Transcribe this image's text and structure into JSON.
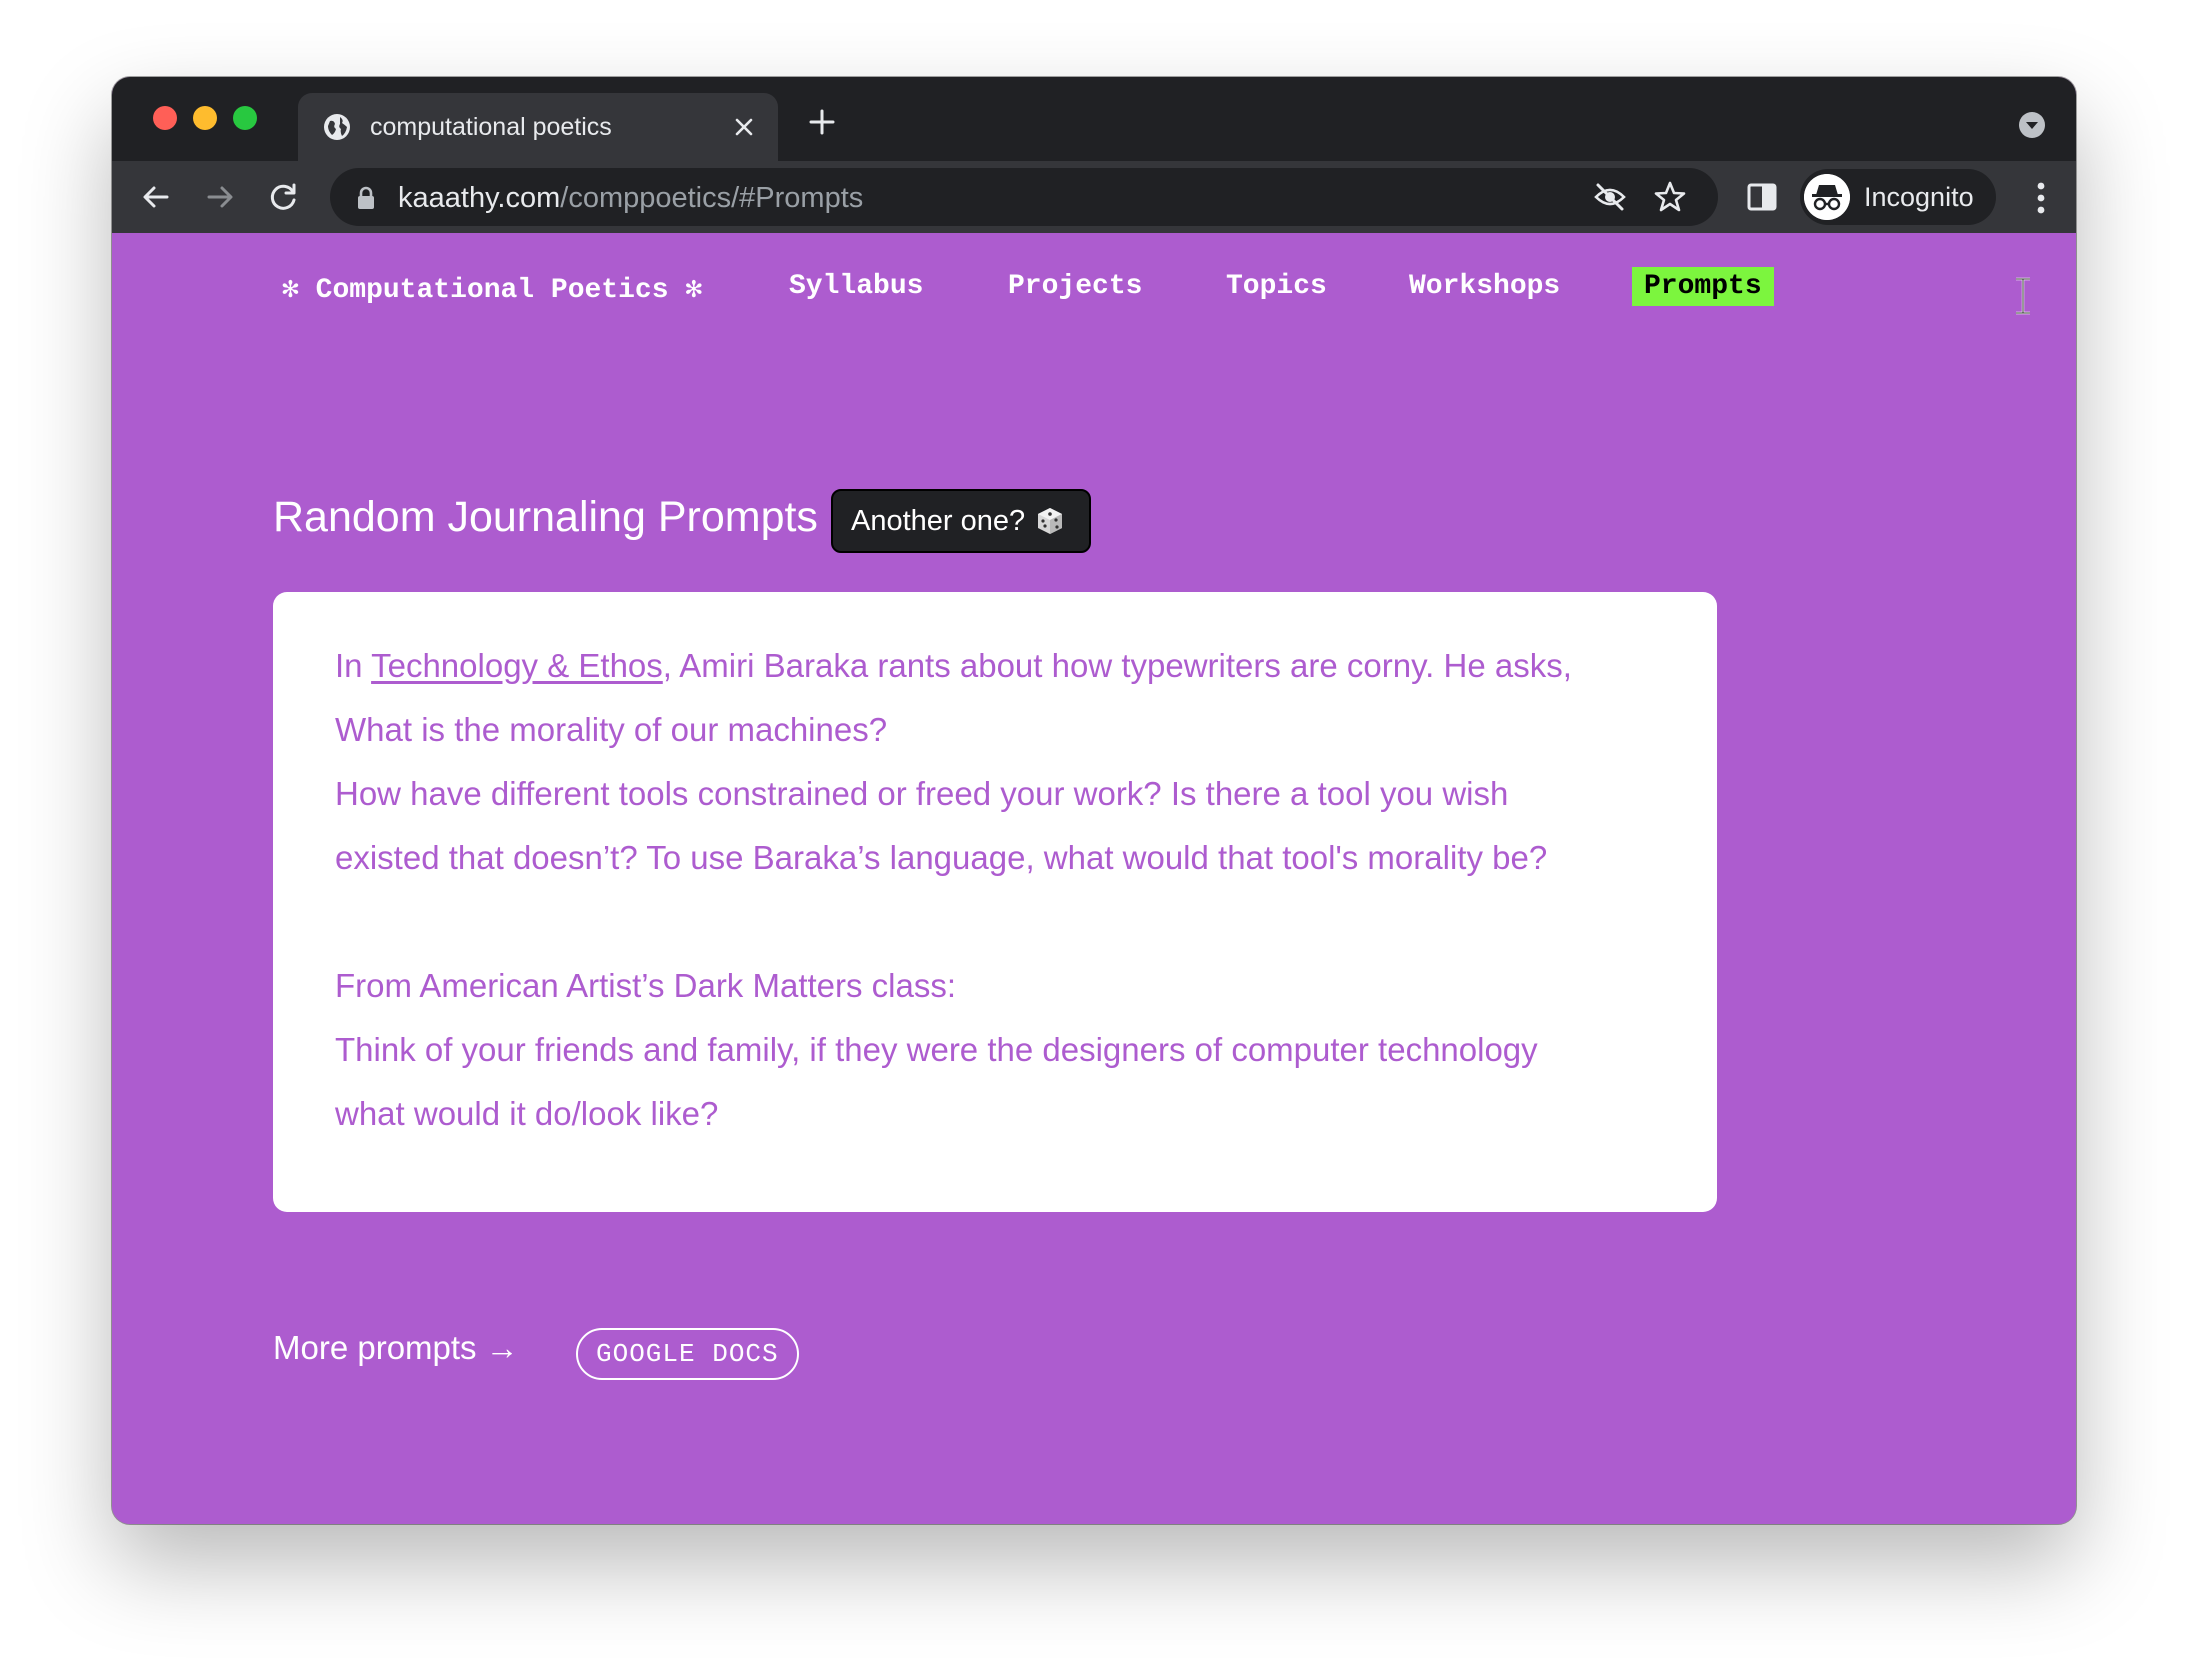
{
  "browser": {
    "tab_title": "computational poetics",
    "url_host": "kaaathy.com",
    "url_path": "/comppoetics/#Prompts",
    "incognito_label": "Incognito"
  },
  "nav": {
    "brand": "✻ Computational Poetics ✻",
    "items": [
      {
        "label": "Syllabus"
      },
      {
        "label": "Projects"
      },
      {
        "label": "Topics"
      },
      {
        "label": "Workshops"
      },
      {
        "label": "Prompts",
        "active": true
      }
    ],
    "active_color": "#7cf53e"
  },
  "main": {
    "heading": "Random Journaling Prompts",
    "another_button": "Another one?",
    "prompt": {
      "intro_prefix": "In ",
      "link_text": "Technology & Ethos",
      "intro_suffix": ", Amiri Baraka rants about how typewriters are corny. He asks,",
      "line2": "What is the morality of our machines?",
      "line3": "How have different tools constrained or freed your work? Is there a tool you wish",
      "line4": "existed that doesn’t? To use Baraka’s language, what would that tool's morality be?",
      "line5": "From American Artist’s Dark Matters class:",
      "line6": "Think of your friends and family, if they were the designers of computer technology",
      "line7": "what would it do/look like?"
    },
    "more_prompts": "More prompts →",
    "google_docs": "GOOGLE DOCS"
  },
  "colors": {
    "page_bg": "#ad5ccf",
    "card_text": "#ad5ccf",
    "button_bg": "#202124"
  },
  "icons": [
    "globe-icon",
    "close-icon",
    "plus-icon",
    "back-icon",
    "forward-icon",
    "reload-icon",
    "lock-icon",
    "eye-off-icon",
    "star-icon",
    "side-panel-icon",
    "incognito-icon",
    "menu-dots-icon",
    "dice-icon",
    "text-cursor-icon",
    "tab-search-icon"
  ]
}
